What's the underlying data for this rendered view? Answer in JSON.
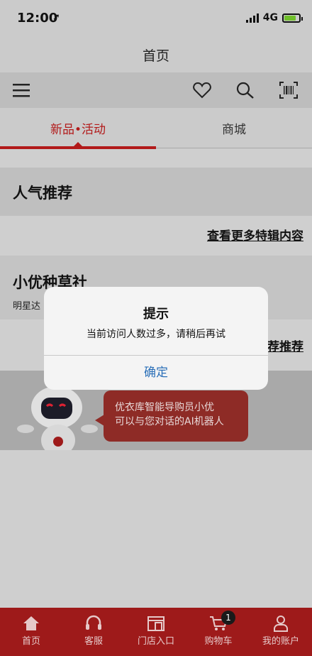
{
  "status": {
    "time": "12:00",
    "network": "4G"
  },
  "header": {
    "title": "首页"
  },
  "toolbar": {
    "icons": [
      "menu-icon",
      "heart-icon",
      "search-icon",
      "barcode-scan-icon"
    ]
  },
  "tabs": [
    {
      "label": "新品•活动",
      "active": true
    },
    {
      "label": "商城",
      "active": false
    }
  ],
  "sections": {
    "popular": {
      "title": "人气推荐",
      "more": "查看更多特辑内容"
    },
    "community": {
      "title": "小优种草社",
      "subtitle": "明星达",
      "more_partial": "荐推荐"
    }
  },
  "banner": {
    "line1": "优衣库智能导购员小优",
    "line2": "可以与您对话的AI机器人"
  },
  "dialog": {
    "title": "提示",
    "message": "当前访问人数过多，请稍后再试",
    "confirm": "确定"
  },
  "bottom_nav": [
    {
      "label": "首页",
      "icon": "home-icon"
    },
    {
      "label": "客服",
      "icon": "headset-icon"
    },
    {
      "label": "门店入口",
      "icon": "store-icon"
    },
    {
      "label": "购物车",
      "icon": "cart-icon",
      "badge": "1"
    },
    {
      "label": "我的账户",
      "icon": "user-icon"
    }
  ],
  "colors": {
    "brand_red": "#b21a1a",
    "nav_red": "#9e1a1a",
    "dialog_link": "#2a6fb8"
  }
}
